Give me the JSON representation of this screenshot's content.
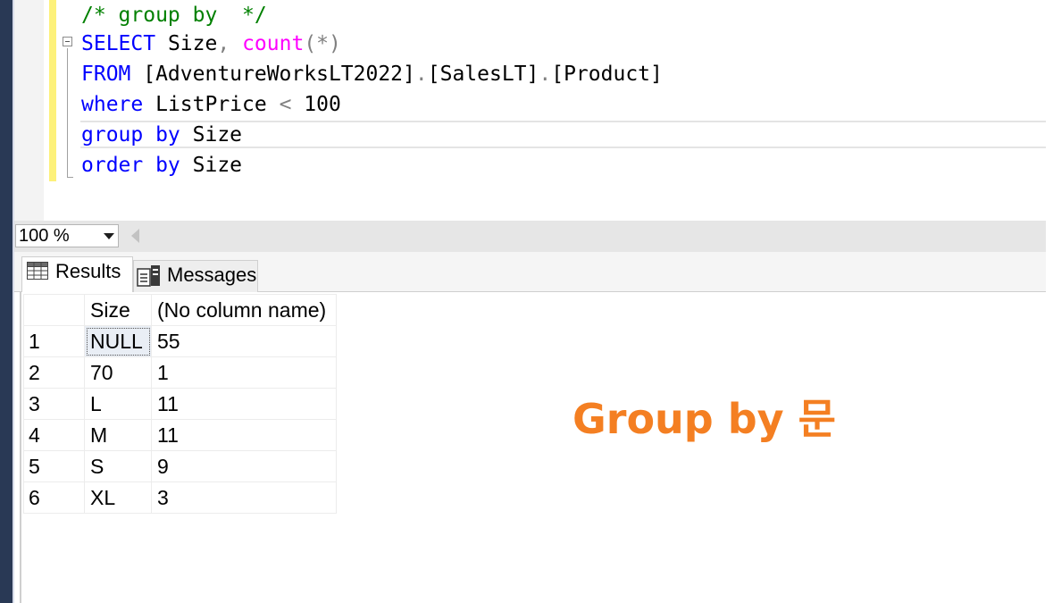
{
  "editor": {
    "lines": [
      {
        "parts": [
          {
            "t": "/* group by  */",
            "c": "cm"
          }
        ]
      },
      {
        "parts": [
          {
            "t": "SELECT",
            "c": "kw"
          },
          {
            "t": " Size",
            "c": ""
          },
          {
            "t": ",",
            "c": "gray"
          },
          {
            "t": " ",
            "c": ""
          },
          {
            "t": "count",
            "c": "fn"
          },
          {
            "t": "(*)",
            "c": "gray"
          }
        ]
      },
      {
        "parts": [
          {
            "t": "FROM",
            "c": "kw"
          },
          {
            "t": " [AdventureWorksLT2022]",
            "c": ""
          },
          {
            "t": ".",
            "c": "gray"
          },
          {
            "t": "[SalesLT]",
            "c": ""
          },
          {
            "t": ".",
            "c": "gray"
          },
          {
            "t": "[Product]",
            "c": ""
          }
        ]
      },
      {
        "parts": [
          {
            "t": "where",
            "c": "kw"
          },
          {
            "t": " ListPrice ",
            "c": ""
          },
          {
            "t": "<",
            "c": "gray"
          },
          {
            "t": " 100",
            "c": ""
          }
        ]
      },
      {
        "parts": [
          {
            "t": "group by",
            "c": "kw"
          },
          {
            "t": " Size",
            "c": ""
          }
        ]
      },
      {
        "parts": [
          {
            "t": "order by",
            "c": "kw"
          },
          {
            "t": " Size",
            "c": ""
          }
        ]
      }
    ]
  },
  "zoom": {
    "value": "100 %"
  },
  "tabs": {
    "results": "Results",
    "messages": "Messages"
  },
  "grid": {
    "columns": [
      "Size",
      "(No column name)"
    ],
    "rows": [
      {
        "num": "1",
        "size": "NULL",
        "count": "55"
      },
      {
        "num": "2",
        "size": "70",
        "count": "1"
      },
      {
        "num": "3",
        "size": "L",
        "count": "11"
      },
      {
        "num": "4",
        "size": "M",
        "count": "11"
      },
      {
        "num": "5",
        "size": "S",
        "count": "9"
      },
      {
        "num": "6",
        "size": "XL",
        "count": "3"
      }
    ]
  },
  "overlay": {
    "title": "Group by 문"
  },
  "colors": {
    "keyword": "#0000ff",
    "function": "#ff00ff",
    "comment": "#008000",
    "operator": "#808080",
    "overlay": "#f47f22"
  }
}
